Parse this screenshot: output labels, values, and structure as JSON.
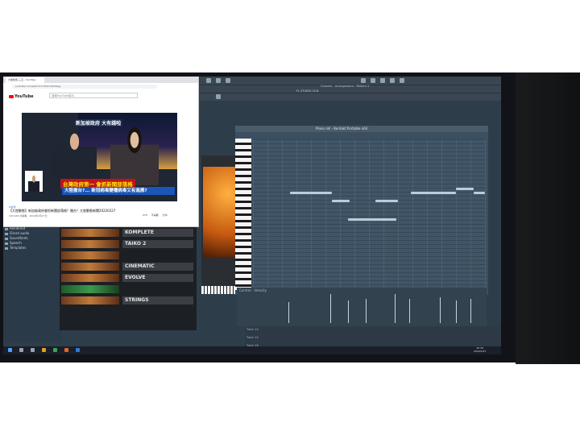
{
  "browser": {
    "tab_title": "大陸動態-三五 - YouTube",
    "url": "youtube.com/watch?v=fSOr1MvZ9qg",
    "search_placeholder": "搜尋YouTube影片",
    "logo": "YouTube"
  },
  "video": {
    "caption_top": "新加坡政府 大有錢啦",
    "caption_main": "台灣政府第一 會抓新聞部落格",
    "caption_sub": "大陸撤台?... 新冠病毒變種病毒又有進展?",
    "hashtag": "#台灣",
    "title": "【大陸動態】新加坡政府會抓新聞部落格？撤台？大陸動態新聞20220227",
    "meta": "183,648 次觀看 · 2022年2月27日",
    "likes": "274",
    "dislikes": "不喜歡",
    "share": "分享"
  },
  "daw": {
    "window_title": "Channel - Arrangement - Pattern 2",
    "version": "FL STUDIO 20.8",
    "piano_roll_title": "Piano roll - Kontakt Portable x64",
    "control_label": "Control - Velocity",
    "browser_items": [
      "Rendered",
      "Sliced audio",
      "Soundfonts",
      "Speech",
      "Templates"
    ],
    "plugins": [
      "KOMPLETE",
      "TAIKO 2",
      "CINEMATIC",
      "EVOLVE",
      "STRINGS"
    ],
    "tracks": [
      "Track 14",
      "Track 15",
      "Track 16"
    ]
  },
  "taskbar": {
    "time": "20:59",
    "date": "2022/2/27"
  }
}
